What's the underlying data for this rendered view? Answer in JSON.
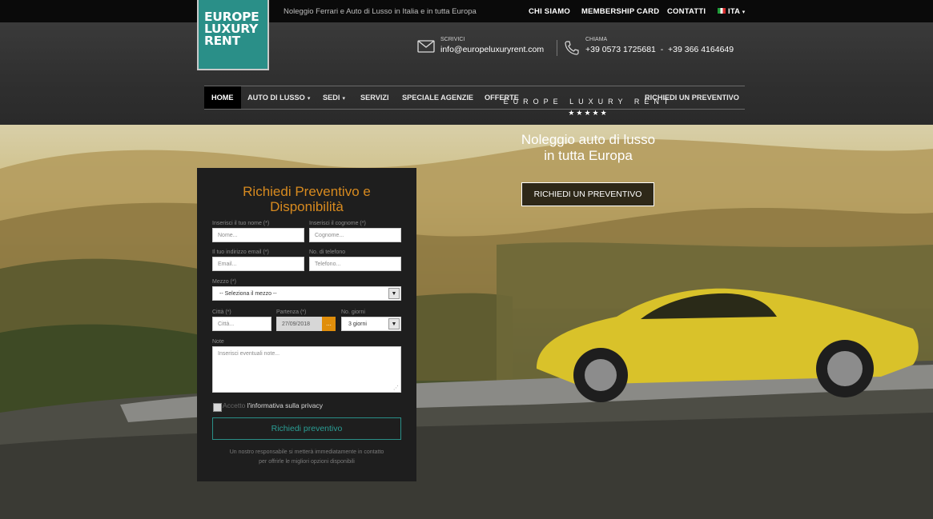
{
  "topbar": {
    "tagline": "Noleggio Ferrari e Auto di Lusso in Italia e in tutta Europa",
    "links": [
      "CHI SIAMO",
      "MEMBERSHIP CARD",
      "CONTATTI"
    ],
    "language": "ITA",
    "language_caret": "▾"
  },
  "logo": {
    "line1": "EUROPE",
    "line2": "LUXURY",
    "line3": "RENT"
  },
  "contact": {
    "email_label": "SCRIVICI",
    "email": "info@europeluxuryrent.com",
    "phone_label": "CHIAMA",
    "phone": "+39 0573 1725681  -  +39 366 4164649"
  },
  "nav": {
    "items": [
      {
        "label": "HOME",
        "caret": ""
      },
      {
        "label": "AUTO DI LUSSO",
        "caret": "▾"
      },
      {
        "label": "SEDI",
        "caret": "▾"
      },
      {
        "label": "SERVIZI",
        "caret": ""
      },
      {
        "label": "SPECIALE AGENZIE",
        "caret": ""
      },
      {
        "label": "OFFERTE",
        "caret": ""
      }
    ],
    "cta": "RICHIEDI UN PREVENTIVO"
  },
  "hero": {
    "brand": "EUROPE LUXURY RENT",
    "stars": "★★★★★",
    "title_line1": "Noleggio auto di lusso",
    "title_line2": "in tutta Europa",
    "cta": "RICHIEDI UN PREVENTIVO"
  },
  "form": {
    "title_line1": "Richiedi Preventivo e",
    "title_line2": "Disponibilità",
    "name_label": "Inserisci il tuo nome (*)",
    "name_placeholder": "Nome...",
    "surname_label": "Inserisci il cognome (*)",
    "surname_placeholder": "Cognome...",
    "email_label": "Il tuo indirizzo email (*)",
    "email_placeholder": "Email...",
    "phone_label": "No. di telefono",
    "phone_placeholder": "Telefono...",
    "vehicle_label": "Mezzo (*)",
    "vehicle_value": "-- Seleziona il mezzo --",
    "city_label": "Città (*)",
    "city_placeholder": "Città...",
    "departure_label": "Partenza (*)",
    "departure_value": "27/09/2018",
    "date_button": "...",
    "days_label": "No. giorni",
    "days_value": "3 giorni",
    "notes_label": "Note",
    "notes_placeholder": "Inserisci eventuali note...",
    "privacy_prefix": "Accetto",
    "privacy_link": "l'informativa sulla privacy",
    "submit": "Richiedi preventivo",
    "footnote_line1": "Un nostro responsabile si metterà immediatamente in contatto",
    "footnote_line2": "per offrirle le migliori opzioni disponibili"
  },
  "colors": {
    "brand_teal": "#2a8f88",
    "form_title_orange": "#d78a1f",
    "date_button": "#e08e0b"
  },
  "icons": [
    "envelope-icon",
    "phone-icon",
    "flag-it-icon",
    "dropdown-arrow-icon",
    "resize-grip-icon"
  ]
}
